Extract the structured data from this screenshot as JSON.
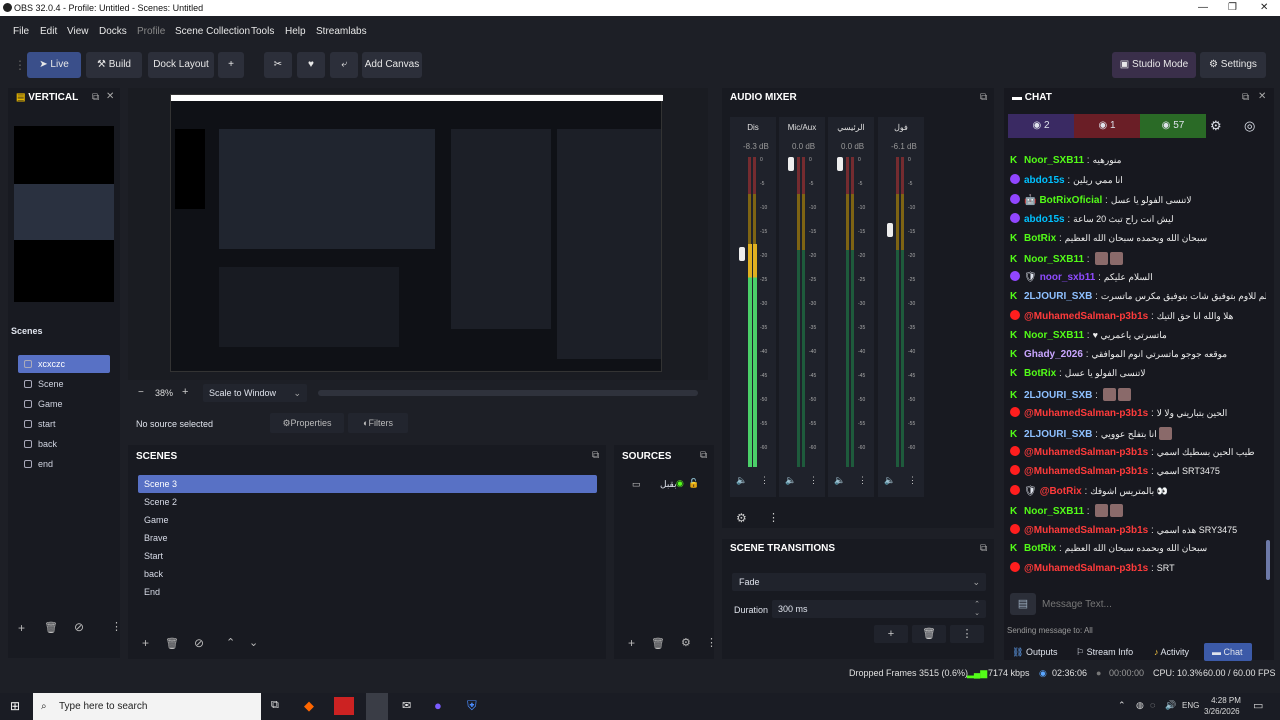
{
  "window": {
    "title": "OBS 32.0.4 - Profile: Untitled - Scenes: Untitled"
  },
  "menu": [
    "File",
    "Edit",
    "View",
    "Docks",
    "Profile",
    "Scene Collection",
    "Tools",
    "Help",
    "Streamlabs"
  ],
  "toolbar": {
    "live": "Live",
    "build": "Build",
    "dock_layout": "Dock Layout",
    "add": "+",
    "add_canvas": "Add Canvas",
    "studio_mode": "Studio Mode",
    "settings": "Settings"
  },
  "vertical": {
    "title": "VERTICAL",
    "scenes_label": "Scenes",
    "scenes": [
      "xcxczc",
      "Scene",
      "Game",
      "start",
      "back",
      "end"
    ]
  },
  "preview": {
    "zoom": "38%",
    "minus": "−",
    "plus": "+",
    "scale_mode": "Scale to Window",
    "no_source": "No source selected",
    "properties": "Properties",
    "filters": "Filters"
  },
  "scenes": {
    "title": "SCENES",
    "items": [
      "Scene 3",
      "Scene 2",
      "Game",
      "Brave",
      "Start",
      "back",
      "End"
    ]
  },
  "sources": {
    "title": "SOURCES",
    "items": [
      {
        "name": "بقبل"
      }
    ]
  },
  "audio_mixer": {
    "title": "AUDIO MIXER",
    "channels": [
      {
        "name": "Dis",
        "db": "-8.3 dB",
        "level": 0.72,
        "fader": 0.7
      },
      {
        "name": "Mic/Aux",
        "db": "0.0 dB",
        "level": 0,
        "fader": 1.0
      },
      {
        "name": "الرئيسي",
        "db": "0.0 dB",
        "level": 0,
        "fader": 1.0
      },
      {
        "name": "فول",
        "db": "-6.1 dB",
        "level": 0,
        "fader": 0.78
      }
    ],
    "scale": [
      "0",
      "-5",
      "-10",
      "-15",
      "-20",
      "-25",
      "-30",
      "-35",
      "-40",
      "-45",
      "-50",
      "-55",
      "-60"
    ]
  },
  "transitions": {
    "title": "SCENE TRANSITIONS",
    "type": "Fade",
    "duration_label": "Duration",
    "duration": "300 ms"
  },
  "chat": {
    "title": "CHAT",
    "counts": {
      "twitch": "2",
      "youtube": "1",
      "kick": "57"
    },
    "messages": [
      {
        "p": "kick",
        "u": "Noor_SXB11",
        "c": "#53fc18",
        "m": "منورهيه"
      },
      {
        "p": "twitch",
        "u": "abdo15s",
        "c": "#00c1ff",
        "m": "انا ممي ريلين"
      },
      {
        "p": "twitch",
        "u": "BotRixOficial",
        "c": "#53fc18",
        "m": "لاتنسى الفولو يا عسل",
        "badge": "🤖"
      },
      {
        "p": "twitch",
        "u": "abdo15s",
        "c": "#00c1ff",
        "m": "ليش انت راح تبث 20 ساعة"
      },
      {
        "p": "kick",
        "u": "BotRix",
        "c": "#53fc18",
        "m": "سبحان الله وبحمده سبحان الله العظيم"
      },
      {
        "p": "kick",
        "u": "Noor_SXB11",
        "c": "#53fc18",
        "m": "",
        "emotes": 2
      },
      {
        "p": "twitch",
        "u": "noor_sxb11",
        "c": "#8f4bff",
        "m": "السلام عليكم",
        "badge": "🛡"
      },
      {
        "p": "kick",
        "u": "2LJOURI_SXB",
        "c": "#8ec0ff",
        "m": "انا استسلم للاوم بتوفيق شات بتوفيق مكرس ماتسرت"
      },
      {
        "p": "youtube",
        "u": "@MuhamedSalman-p3b1s",
        "c": "#ff3b3b",
        "m": "هلا والله انا حق التيك"
      },
      {
        "p": "kick",
        "u": "Noor_SXB11",
        "c": "#53fc18",
        "m": "♥ ماتسرتي ياعمريي"
      },
      {
        "p": "kick",
        "u": "Ghady_2026",
        "c": "#c9a6ff",
        "m": "موقعه جوجو ماتسرتي انوم الموافقي"
      },
      {
        "p": "kick",
        "u": "BotRix",
        "c": "#53fc18",
        "m": "لاتنسى الفولو يا عسل"
      },
      {
        "p": "kick",
        "u": "2LJOURI_SXB",
        "c": "#8ec0ff",
        "m": "",
        "emotes": 2
      },
      {
        "p": "youtube",
        "u": "@MuhamedSalman-p3b1s",
        "c": "#ff3b3b",
        "m": "الحين بتباريني ولا لا"
      },
      {
        "p": "kick",
        "u": "2LJOURI_SXB",
        "c": "#8ec0ff",
        "m": "انا بتفلح عوويي",
        "emotes": 1
      },
      {
        "p": "youtube",
        "u": "@MuhamedSalman-p3b1s",
        "c": "#ff3b3b",
        "m": "طيب الحين بسطيك اسمي"
      },
      {
        "p": "youtube",
        "u": "@MuhamedSalman-p3b1s",
        "c": "#ff3b3b",
        "m": "اسمي SRT3475"
      },
      {
        "p": "youtube",
        "u": "@BotRix",
        "c": "#ff3b3b",
        "m": "بالمتريس اشوفك 👀",
        "badge": "🛡"
      },
      {
        "p": "kick",
        "u": "Noor_SXB11",
        "c": "#53fc18",
        "m": "",
        "emotes": 2
      },
      {
        "p": "youtube",
        "u": "@MuhamedSalman-p3b1s",
        "c": "#ff3b3b",
        "m": "هذه اسمي SRY3475"
      },
      {
        "p": "kick",
        "u": "BotRix",
        "c": "#53fc18",
        "m": "سبحان الله وبحمده سبحان الله العظيم"
      },
      {
        "p": "youtube",
        "u": "@MuhamedSalman-p3b1s",
        "c": "#ff3b3b",
        "m": "SRT"
      }
    ],
    "input_placeholder": "Message Text...",
    "sending_to": "Sending message to: All",
    "tabs": [
      "Outputs",
      "Stream Info",
      "Activity",
      "Chat"
    ]
  },
  "status": {
    "dropped": "Dropped Frames 3515 (0.6%)",
    "kbps": "7174 kbps",
    "time": "02:36:06",
    "rec": "00:00:00",
    "cpu": "CPU: 10.3%",
    "fps": "60.00 / 60.00 FPS"
  },
  "taskbar": {
    "search": "Type here to search",
    "lang": "ENG",
    "time": "4:28 PM",
    "date": "3/26/2026"
  }
}
